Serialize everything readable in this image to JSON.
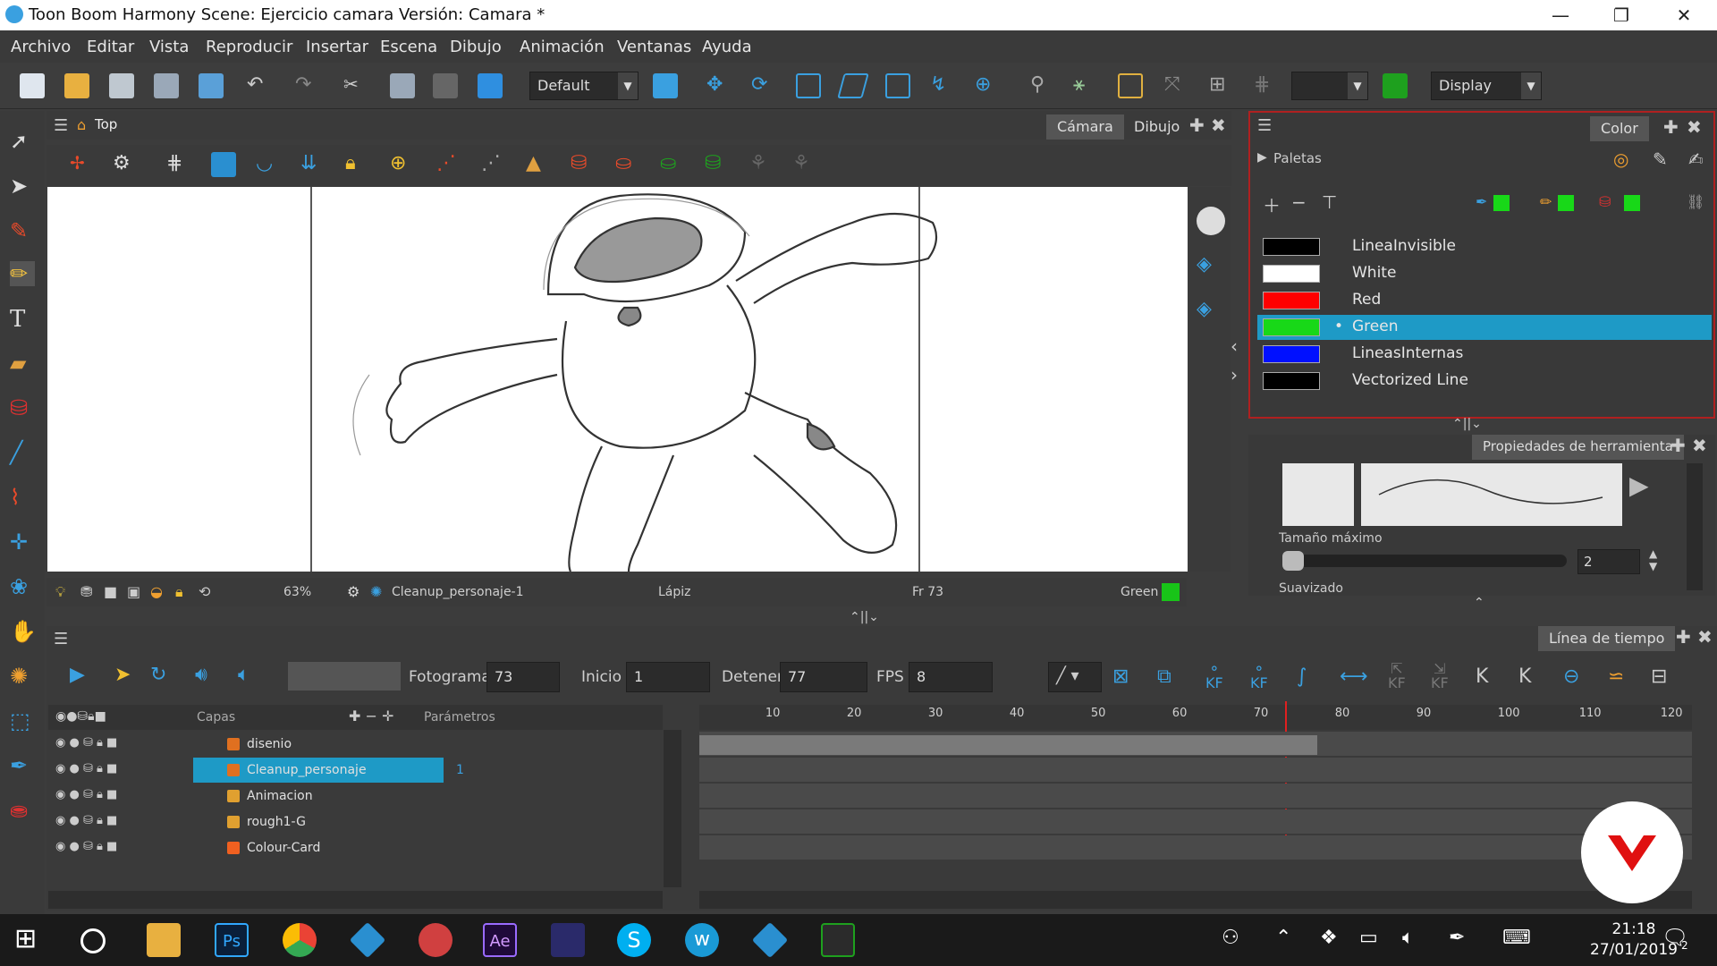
{
  "titlebar": {
    "title": "Toon Boom Harmony Scene: Ejercicio camara Versión: Camara *",
    "minimize": "—",
    "restore": "❐",
    "close": "✕"
  },
  "menu": [
    "Archivo",
    "Editar",
    "Vista",
    "Reproducir",
    "Insertar",
    "Escena",
    "Dibujo",
    "Animación",
    "Ventanas",
    "Ayuda"
  ],
  "toolbar": {
    "workspace_value": "Default",
    "display_value": "Display"
  },
  "camera": {
    "breadcrumb": "Top",
    "tabs": [
      "Cámara",
      "Dibujo"
    ],
    "zoom": "63%",
    "drawing_name": "Cleanup_personaje-1",
    "tool_name": "Lápiz",
    "frame": "Fr 73",
    "color_name": "Green",
    "color_swatch": "#18c418"
  },
  "color_panel": {
    "tab": "Color",
    "palettes_label": "Paletas",
    "swatches": [
      {
        "name": "LineaInvisible",
        "color": "#000000"
      },
      {
        "name": "White",
        "color": "#ffffff"
      },
      {
        "name": "Red",
        "color": "#ff0000"
      },
      {
        "name": "Green",
        "color": "#18d818",
        "selected": true
      },
      {
        "name": "LineasInternas",
        "color": "#0010ff"
      },
      {
        "name": "Vectorized Line",
        "color": "#000000"
      }
    ],
    "selected_bg": "#1e9ac6"
  },
  "tool_properties": {
    "tab": "Propiedades de herramienta",
    "max_size_label": "Tamaño máximo",
    "max_size_value": "2",
    "smoothing_label": "Suavizado"
  },
  "timeline": {
    "tab": "Línea de tiempo",
    "frame_label": "Fotograma",
    "frame_value": "73",
    "start_label": "Inicio",
    "start_value": "1",
    "stop_label": "Detener",
    "stop_value": "77",
    "fps_label": "FPS",
    "fps_value": "8",
    "layers_header": "Capas",
    "params_header": "Parámetros",
    "kf_label": "KF",
    "layers": [
      {
        "name": "disenio",
        "icon_color": "#e07020",
        "selected": false,
        "value": ""
      },
      {
        "name": "Cleanup_personaje",
        "icon_color": "#e07020",
        "selected": true,
        "value": "1"
      },
      {
        "name": "Animacion",
        "icon_color": "#e0a030",
        "selected": false,
        "value": ""
      },
      {
        "name": "rough1-G",
        "icon_color": "#e0a030",
        "selected": false,
        "value": ""
      },
      {
        "name": "Colour-Card",
        "icon_color": "#f06020",
        "selected": false,
        "value": ""
      }
    ],
    "ruler_ticks": [
      "10",
      "20",
      "30",
      "40",
      "50",
      "60",
      "70",
      "80",
      "90",
      "100",
      "110",
      "120"
    ],
    "playhead_frame": 73
  },
  "taskbar": {
    "time": "21:18",
    "date": "27/01/2019",
    "notifications": "2"
  }
}
